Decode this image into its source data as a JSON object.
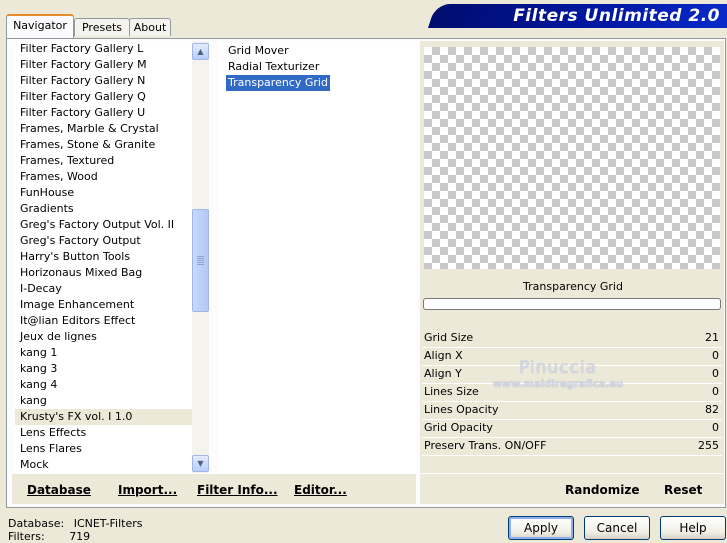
{
  "tabs": [
    {
      "label": "Navigator",
      "active": true
    },
    {
      "label": "Presets",
      "active": false
    },
    {
      "label": "About",
      "active": false
    }
  ],
  "title": "Filters Unlimited 2.0",
  "categories": [
    "Filter Factory Gallery L",
    "Filter Factory Gallery M",
    "Filter Factory Gallery N",
    "Filter Factory Gallery Q",
    "Filter Factory Gallery U",
    "Frames, Marble & Crystal",
    "Frames, Stone & Granite",
    "Frames, Textured",
    "Frames, Wood",
    "FunHouse",
    "Gradients",
    "Greg's Factory Output Vol. II",
    "Greg's Factory Output",
    "Harry's Button Tools",
    "Horizonaus Mixed Bag",
    "I-Decay",
    "Image Enhancement",
    "It@lian Editors Effect",
    "Jeux de lignes",
    "kang 1",
    "kang 3",
    "kang 4",
    "kang",
    "Krusty's FX vol. I 1.0",
    "Lens Effects",
    "Lens Flares",
    "Mock"
  ],
  "selected_category": "Krusty's FX vol. I 1.0",
  "filters": [
    "Grid Mover",
    "Radial Texturizer",
    "Transparency Grid"
  ],
  "selected_filter": "Transparency Grid",
  "preview": {
    "filter_name": "Transparency Grid",
    "progress": 0
  },
  "params": [
    {
      "label": "Grid Size",
      "value": "21"
    },
    {
      "label": "Align X",
      "value": "0"
    },
    {
      "label": "Align Y",
      "value": "0"
    },
    {
      "label": "Lines Size",
      "value": "0"
    },
    {
      "label": "Lines Opacity",
      "value": "82"
    },
    {
      "label": "Grid Opacity",
      "value": "0"
    },
    {
      "label": "Preserv Trans. ON/OFF",
      "value": "255"
    }
  ],
  "watermark": {
    "line1": "Pinuccia",
    "line2": "www.maidiregrafica.eu"
  },
  "toolbar": {
    "database": "Database",
    "import": "Import...",
    "filter_info": "Filter Info...",
    "editor": "Editor...",
    "randomize": "Randomize",
    "reset": "Reset"
  },
  "status": {
    "database_label": "Database:",
    "database_value": "ICNET-Filters",
    "filters_label": "Filters:",
    "filters_value": "719"
  },
  "buttons": {
    "apply": "Apply",
    "cancel": "Cancel",
    "help": "Help"
  },
  "icons": {
    "scroll_up": "chevron-up-icon",
    "scroll_down": "chevron-down-icon"
  }
}
